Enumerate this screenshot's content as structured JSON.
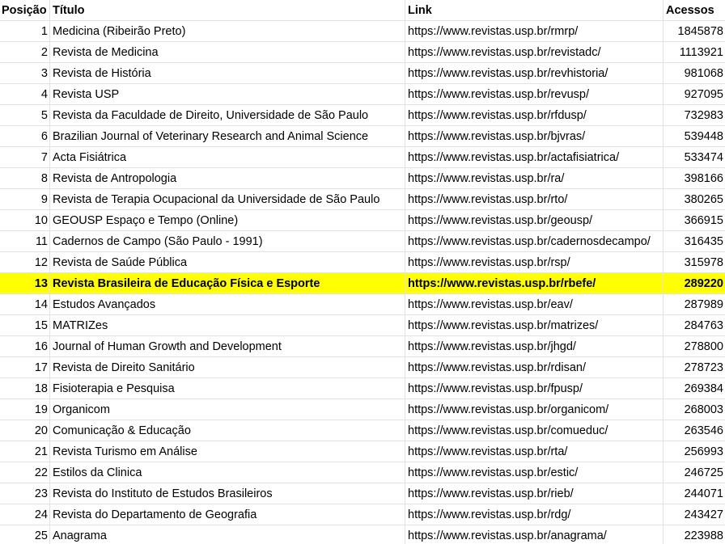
{
  "columns": {
    "position": "Posição",
    "title": "Título",
    "link": "Link",
    "accesses": "Acessos"
  },
  "highlight_color": "#ffff00",
  "rows": [
    {
      "pos": "1",
      "title": "Medicina (Ribeirão Preto)",
      "link": "https://www.revistas.usp.br/rmrp/",
      "acc": "1845878",
      "highlight": false
    },
    {
      "pos": "2",
      "title": "Revista de Medicina",
      "link": "https://www.revistas.usp.br/revistadc/",
      "acc": "1113921",
      "highlight": false
    },
    {
      "pos": "3",
      "title": "Revista de História",
      "link": "https://www.revistas.usp.br/revhistoria/",
      "acc": "981068",
      "highlight": false
    },
    {
      "pos": "4",
      "title": "Revista USP",
      "link": "https://www.revistas.usp.br/revusp/",
      "acc": "927095",
      "highlight": false
    },
    {
      "pos": "5",
      "title": "Revista da Faculdade de Direito, Universidade de São Paulo",
      "link": "https://www.revistas.usp.br/rfdusp/",
      "acc": "732983",
      "highlight": false
    },
    {
      "pos": "6",
      "title": "Brazilian Journal of Veterinary Research and Animal Science",
      "link": "https://www.revistas.usp.br/bjvras/",
      "acc": "539448",
      "highlight": false
    },
    {
      "pos": "7",
      "title": "Acta Fisiátrica",
      "link": "https://www.revistas.usp.br/actafisiatrica/",
      "acc": "533474",
      "highlight": false
    },
    {
      "pos": "8",
      "title": "Revista de Antropologia",
      "link": "https://www.revistas.usp.br/ra/",
      "acc": "398166",
      "highlight": false
    },
    {
      "pos": "9",
      "title": "Revista de Terapia Ocupacional da Universidade de São Paulo",
      "link": "https://www.revistas.usp.br/rto/",
      "acc": "380265",
      "highlight": false
    },
    {
      "pos": "10",
      "title": "GEOUSP Espaço e Tempo (Online)",
      "link": "https://www.revistas.usp.br/geousp/",
      "acc": "366915",
      "highlight": false
    },
    {
      "pos": "11",
      "title": "Cadernos de Campo (São Paulo - 1991)",
      "link": "https://www.revistas.usp.br/cadernosdecampo/",
      "acc": "316435",
      "highlight": false
    },
    {
      "pos": "12",
      "title": "Revista de Saúde Pública",
      "link": "https://www.revistas.usp.br/rsp/",
      "acc": "315978",
      "highlight": false
    },
    {
      "pos": "13",
      "title": "Revista Brasileira de Educação Física e Esporte",
      "link": "https://www.revistas.usp.br/rbefe/",
      "acc": "289220",
      "highlight": true
    },
    {
      "pos": "14",
      "title": "Estudos Avançados",
      "link": "https://www.revistas.usp.br/eav/",
      "acc": "287989",
      "highlight": false
    },
    {
      "pos": "15",
      "title": "MATRIZes",
      "link": "https://www.revistas.usp.br/matrizes/",
      "acc": "284763",
      "highlight": false
    },
    {
      "pos": "16",
      "title": "Journal of Human Growth and Development",
      "link": "https://www.revistas.usp.br/jhgd/",
      "acc": "278800",
      "highlight": false
    },
    {
      "pos": "17",
      "title": "Revista de Direito Sanitário",
      "link": "https://www.revistas.usp.br/rdisan/",
      "acc": "278723",
      "highlight": false
    },
    {
      "pos": "18",
      "title": "Fisioterapia e Pesquisa",
      "link": "https://www.revistas.usp.br/fpusp/",
      "acc": "269384",
      "highlight": false
    },
    {
      "pos": "19",
      "title": "Organicom",
      "link": "https://www.revistas.usp.br/organicom/",
      "acc": "268003",
      "highlight": false
    },
    {
      "pos": "20",
      "title": "Comunicação & Educação",
      "link": "https://www.revistas.usp.br/comueduc/",
      "acc": "263546",
      "highlight": false
    },
    {
      "pos": "21",
      "title": "Revista Turismo em Análise",
      "link": "https://www.revistas.usp.br/rta/",
      "acc": "256993",
      "highlight": false
    },
    {
      "pos": "22",
      "title": "Estilos da Clinica",
      "link": "https://www.revistas.usp.br/estic/",
      "acc": "246725",
      "highlight": false
    },
    {
      "pos": "23",
      "title": "Revista do Instituto de Estudos Brasileiros",
      "link": "https://www.revistas.usp.br/rieb/",
      "acc": "244071",
      "highlight": false
    },
    {
      "pos": "24",
      "title": "Revista do Departamento de Geografia",
      "link": "https://www.revistas.usp.br/rdg/",
      "acc": "243427",
      "highlight": false
    },
    {
      "pos": "25",
      "title": "Anagrama",
      "link": "https://www.revistas.usp.br/anagrama/",
      "acc": "223988",
      "highlight": false
    }
  ]
}
